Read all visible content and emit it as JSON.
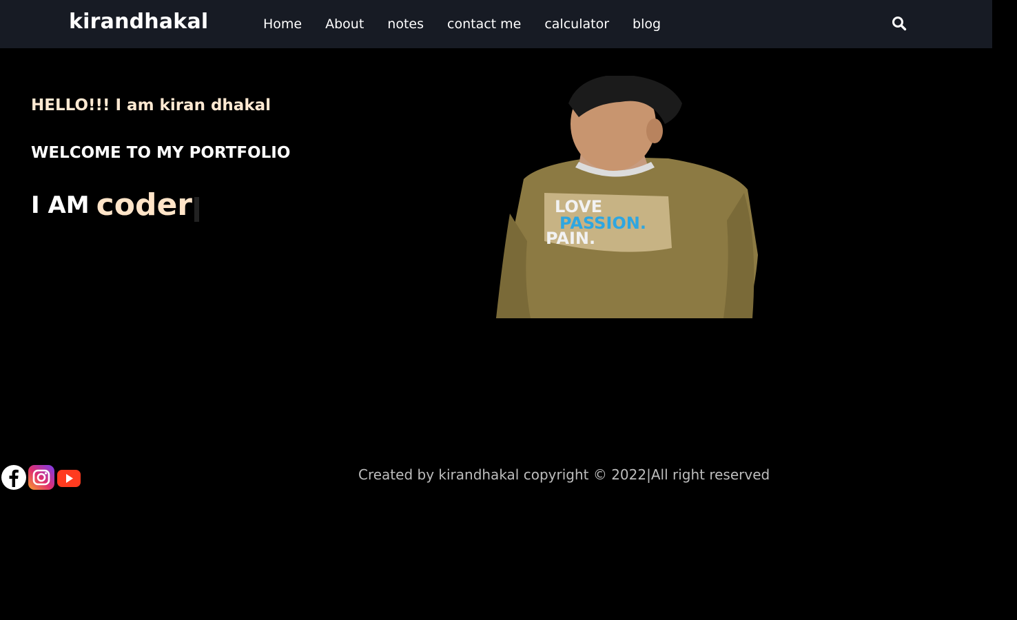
{
  "navbar": {
    "logo": "kirandhakal",
    "links": [
      "Home",
      "About",
      "notes",
      "contact me",
      "calculator",
      "blog"
    ],
    "search_icon": "search-icon",
    "background": "#171b24"
  },
  "hero": {
    "hello": "HELLO!!! I am kiran dhakal",
    "welcome": "WELCOME TO MY PORTFOLIO",
    "iam_prefix": "I AM",
    "iam_role": "coder",
    "shirt_text": [
      "LOVE",
      "PASSION.",
      "PAIN."
    ]
  },
  "footer": {
    "socials": [
      "facebook-icon",
      "instagram-icon",
      "youtube-icon"
    ],
    "copyright": "Created by kirandhakal copyright © 2022|All right reserved"
  },
  "colors": {
    "accent": "#ffe4c8",
    "text": "#ffffff",
    "muted": "#bdbdbd"
  }
}
